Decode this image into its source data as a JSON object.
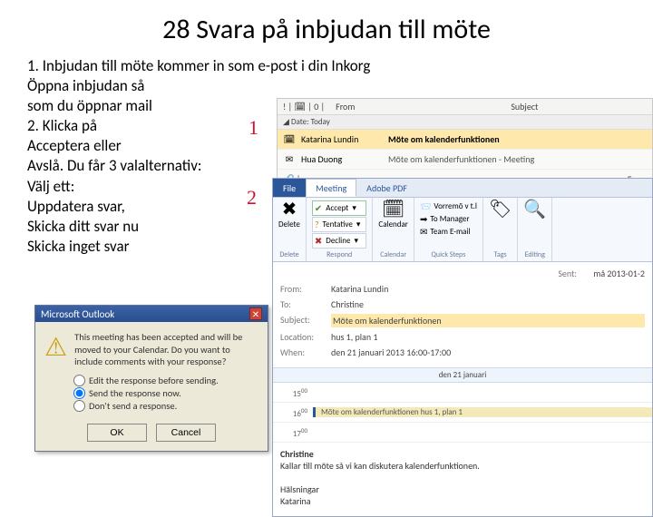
{
  "title": "28 Svara på inbjudan till möte",
  "body": [
    "1. Inbjudan till möte kommer in som e-post i din Inkorg",
    " Öppna inbjudan så",
    "som du öppnar mail",
    "2. Klicka på",
    " Acceptera eller",
    "Avslå. Du får 3 valalternativ:",
    "Välj ett:",
    "Uppdatera svar,",
    "Skicka ditt svar nu",
    "Skicka inget svar"
  ],
  "annot": {
    "n1": "1",
    "n2": "2"
  },
  "inbox": {
    "col_from": "From",
    "col_subject": "Subject",
    "date_group": "Date: Today",
    "rows": [
      {
        "from": "Katarina Lundin",
        "subject": "Möte om kalenderfunktionen",
        "selected": true
      },
      {
        "from": "Hua Duong",
        "subject": "Möte om kalenderfunktionen - Meeting",
        "selected": false
      }
    ],
    "meta_from": "From"
  },
  "meeting": {
    "tabs": {
      "file": "File",
      "meeting": "Meeting",
      "adobe": "Adobe PDF"
    },
    "delete": {
      "label": "Delete",
      "group": "Delete"
    },
    "respond": {
      "accept": "Accept",
      "tentative": "Tentative",
      "decline": "Decline",
      "group": "Respond"
    },
    "calendar": {
      "label": "Calendar",
      "group": "Calendar"
    },
    "quicksteps": {
      "items": [
        "Vorremö v t.l",
        "To Manager",
        "Team E-mail"
      ],
      "group": "Quick Steps"
    },
    "tags": {
      "label": "Tags"
    },
    "editing": {
      "label": "Editing"
    },
    "fields": {
      "from_k": "From:",
      "from_v": "Katarina Lundin",
      "to_k": "To:",
      "to_v": "Christine",
      "subject_k": "Subject:",
      "subject_v": "Möte om kalenderfunktionen",
      "location_k": "Location:",
      "location_v": "hus 1, plan 1",
      "when_k": "When:",
      "when_v": "den 21 januari 2013 16:00-17:00",
      "sent_k": "Sent:",
      "sent_v": "må 2013-01-2"
    },
    "cal": {
      "header": "den 21 januari",
      "rows": [
        {
          "t": "15",
          "s": "00",
          "ev": ""
        },
        {
          "t": "16",
          "s": "00",
          "ev": "Möte om kalenderfunktionen\nhus 1, plan 1",
          "busy": true
        },
        {
          "t": "17",
          "s": "00",
          "ev": ""
        }
      ]
    },
    "msg": {
      "name": "Christine",
      "line": "Kallar till möte så vi kan diskutera kalenderfunktionen.",
      "sign1": "Hälsningar",
      "sign2": "Katarina"
    }
  },
  "dialog": {
    "title": "Microsoft Outlook",
    "text": "This meeting has been accepted and will be moved to your Calendar. Do you want to include comments with your response?",
    "opts": [
      "Edit the response before sending.",
      "Send the response now.",
      "Don't send a response."
    ],
    "ok": "OK",
    "cancel": "Cancel"
  }
}
